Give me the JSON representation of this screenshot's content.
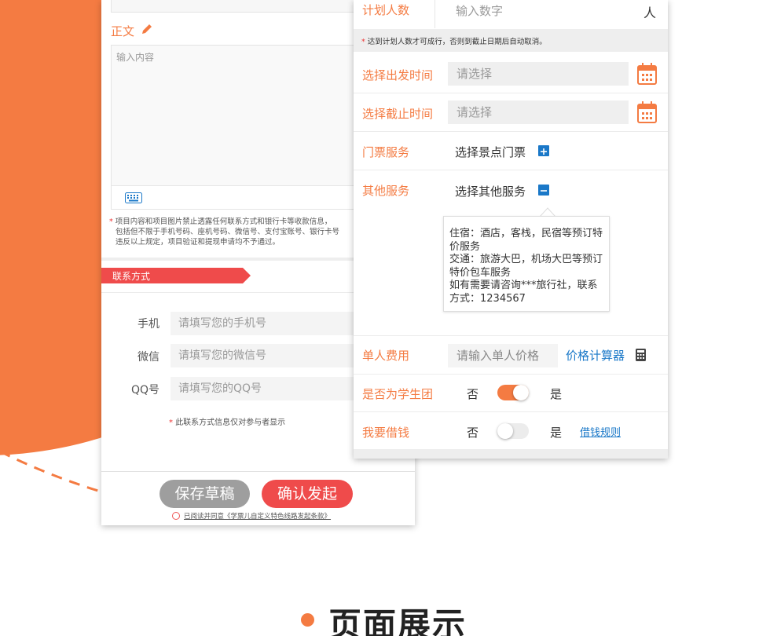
{
  "colors": {
    "accent": "#f47b42",
    "red": "#ef4b4b",
    "blue": "#1a78c8",
    "gray_button": "#9e9e9e"
  },
  "left": {
    "body_label": "正文",
    "content_placeholder": "输入内容",
    "warning_star": "*",
    "warning_lines": [
      "项目内容和项目图片禁止透露任何联系方式和银行卡等收款信息，",
      "包括但不限于手机号码、座机号码、微信号、支付宝账号、银行卡号",
      "违反以上规定，项目验证和提现申请均不予通过。"
    ],
    "contact_title": "联系方式",
    "fields": [
      {
        "label": "手机",
        "placeholder": "请填写您的手机号"
      },
      {
        "label": "微信",
        "placeholder": "请填写您的微信号"
      },
      {
        "label": "QQ号",
        "placeholder": "请填写您的QQ号"
      }
    ],
    "contact_note_star": "*",
    "contact_note": "此联系方式信息仅对参与者显示",
    "save_draft": "保存草稿",
    "confirm": "确认发起",
    "agreement": "已阅读并同意《学票儿自定义特色线路发起条款》"
  },
  "right": {
    "planned_label": "计划人数",
    "planned_placeholder": "输入数字",
    "planned_unit": "人",
    "note_star": "*",
    "note": "达到计划人数才可成行，否则到截止日期后自动取消。",
    "depart_label": "选择出发时间",
    "depart_placeholder": "请选择",
    "deadline_label": "选择截止时间",
    "deadline_placeholder": "请选择",
    "ticket_label": "门票服务",
    "ticket_text": "选择景点门票",
    "other_label": "其他服务",
    "other_text": "选择其他服务",
    "tooltip_lines": [
      "住宿：酒店，客栈，民宿等预订特",
      "价服务",
      "交通：旅游大巴，机场大巴等预订",
      "特价包车服务",
      "如有需要请咨询***旅行社，联系",
      "方式：1234567"
    ],
    "price_label": "单人费用",
    "price_placeholder": "请输入单人价格",
    "price_calc": "价格计算器",
    "student_label": "是否为学生团",
    "no": "否",
    "yes": "是",
    "student_toggle_on": true,
    "loan_label": "我要借钱",
    "loan_toggle_on": false,
    "loan_rules": "借钱规则"
  },
  "caption": "页面展示"
}
